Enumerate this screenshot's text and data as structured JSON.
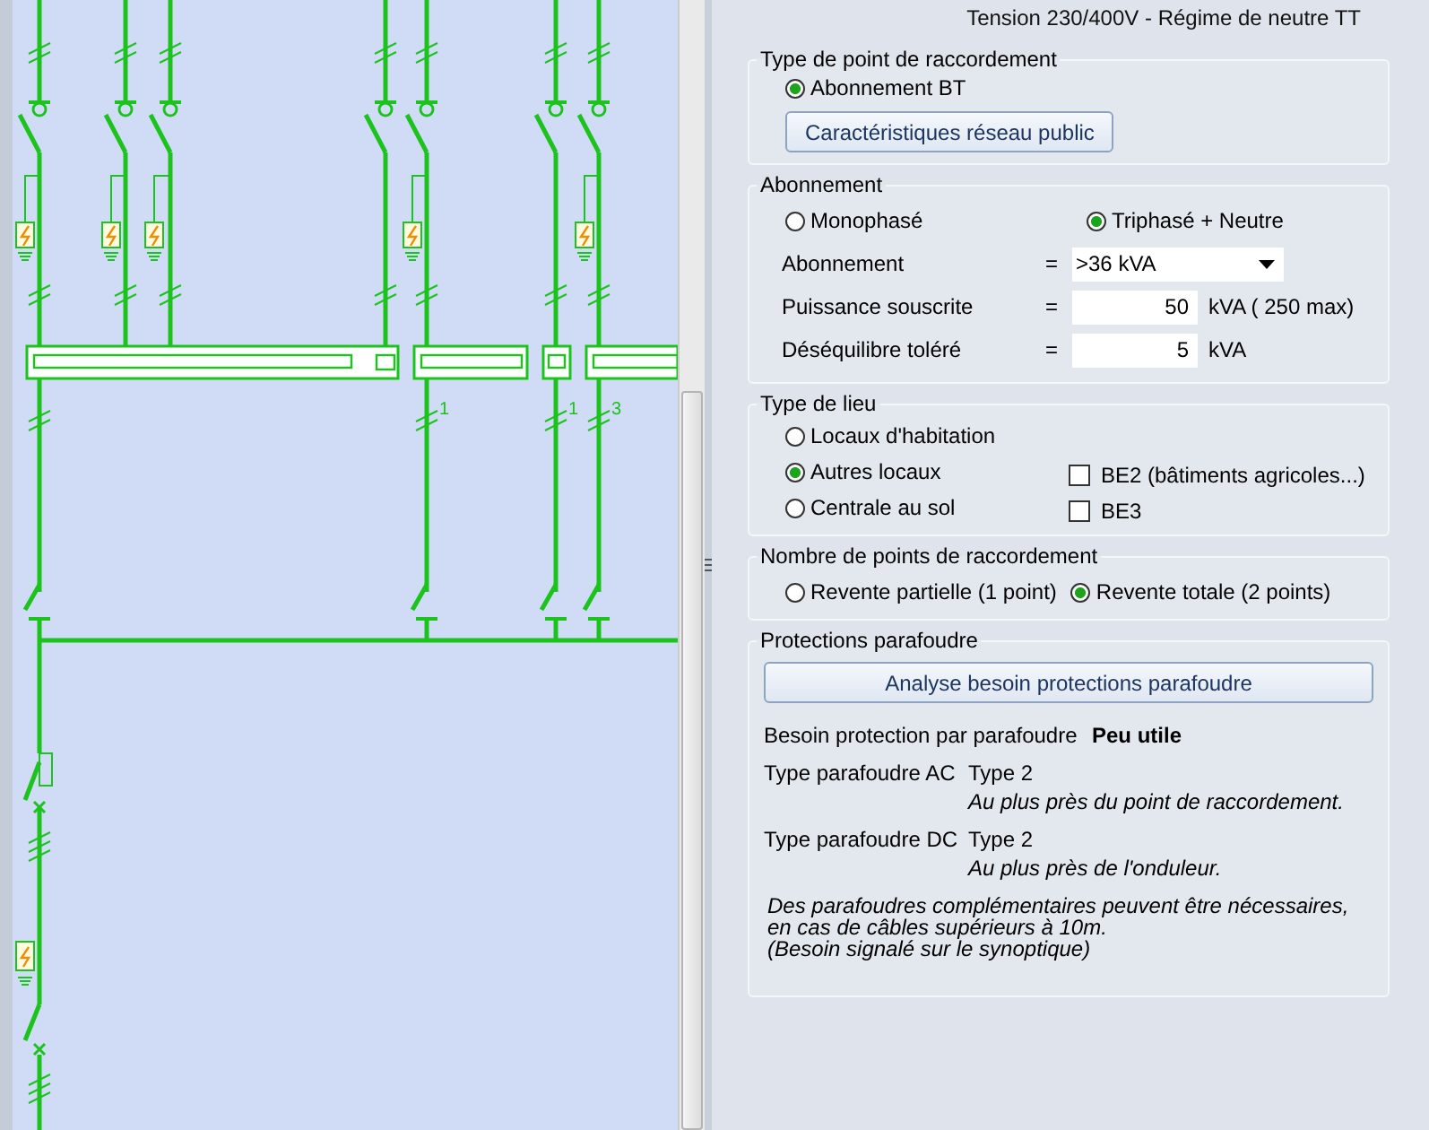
{
  "diagram": {
    "circuit_labels": [
      "1",
      "1",
      "3"
    ]
  },
  "header": "Tension 230/400V - Régime de neutre TT",
  "connection_point": {
    "title": "Type de point de raccordement",
    "options": [
      {
        "label": "Abonnement BT",
        "selected": true
      }
    ],
    "button": "Caractéristiques réseau public"
  },
  "subscription": {
    "title": "Abonnement",
    "options": [
      {
        "label": "Monophasé",
        "selected": false
      },
      {
        "label": "Triphasé + Neutre",
        "selected": true
      }
    ],
    "fields": [
      {
        "kind": "dropdown",
        "label": "Abonnement",
        "equals": "=",
        "value": ">36 kVA"
      },
      {
        "kind": "input",
        "label": "Puissance souscrite",
        "equals": "=",
        "value": "50",
        "unit": "kVA ( 250 max)"
      },
      {
        "kind": "input",
        "label": "Déséquilibre toléré",
        "equals": "=",
        "value": "5",
        "unit": "kVA"
      }
    ]
  },
  "site_type": {
    "title": "Type de lieu",
    "options": [
      {
        "label": "Locaux d'habitation",
        "selected": false
      },
      {
        "label": "Autres locaux",
        "selected": true
      },
      {
        "label": "Centrale au sol",
        "selected": false
      }
    ],
    "checkboxes": [
      {
        "label": "BE2 (bâtiments agricoles...)",
        "checked": false
      },
      {
        "label": "BE3",
        "checked": false
      }
    ]
  },
  "connection_count": {
    "title": "Nombre de points de raccordement",
    "options": [
      {
        "label": "Revente partielle (1 point)",
        "selected": false
      },
      {
        "label": "Revente totale (2 points)",
        "selected": true
      }
    ]
  },
  "surge_protection": {
    "title": "Protections parafoudre",
    "button": "Analyse besoin protections parafoudre",
    "need": {
      "label": "Besoin protection par parafoudre",
      "value": "Peu utile"
    },
    "rows": [
      {
        "label": "Type parafoudre AC",
        "value": "Type 2",
        "note": "Au plus près du point de raccordement."
      },
      {
        "label": "Type parafoudre DC",
        "value": "Type 2",
        "note": "Au plus près de l'onduleur."
      }
    ],
    "remark": [
      "Des parafoudres complémentaires peuvent être nécessaires,",
      "en cas de câbles supérieurs à 10m.",
      "(Besoin signalé sur le synoptique)"
    ]
  }
}
